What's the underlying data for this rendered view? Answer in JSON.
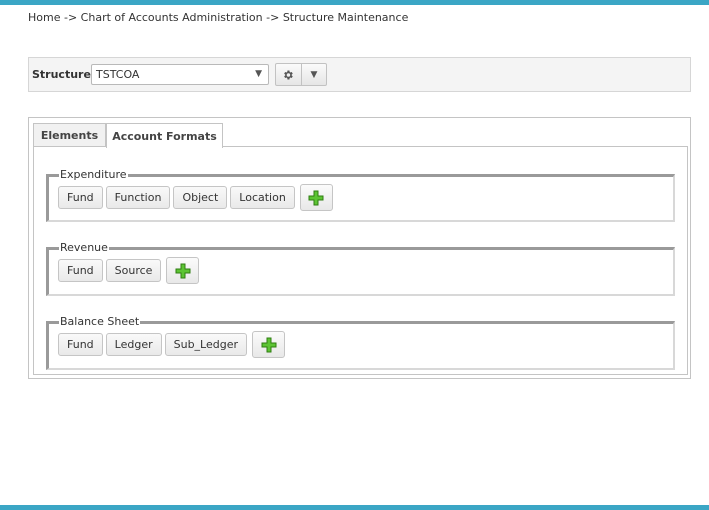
{
  "breadcrumb": {
    "home": "Home",
    "sep": " -> ",
    "coa": "Chart of Accounts Administration",
    "current": "Structure Maintenance"
  },
  "structure": {
    "label": "Structure:",
    "selected": "TSTCOA"
  },
  "tabs": [
    {
      "label": "Elements",
      "active": false
    },
    {
      "label": "Account Formats",
      "active": true
    }
  ],
  "account_formats": [
    {
      "title": "Expenditure",
      "segments": [
        "Fund",
        "Function",
        "Object",
        "Location"
      ]
    },
    {
      "title": "Revenue",
      "segments": [
        "Fund",
        "Source"
      ]
    },
    {
      "title": "Balance Sheet",
      "segments": [
        "Fund",
        "Ledger",
        "Sub_Ledger"
      ]
    }
  ],
  "colors": {
    "accent_bar": "#3ba6c5",
    "add_icon": "#4caf2a"
  }
}
